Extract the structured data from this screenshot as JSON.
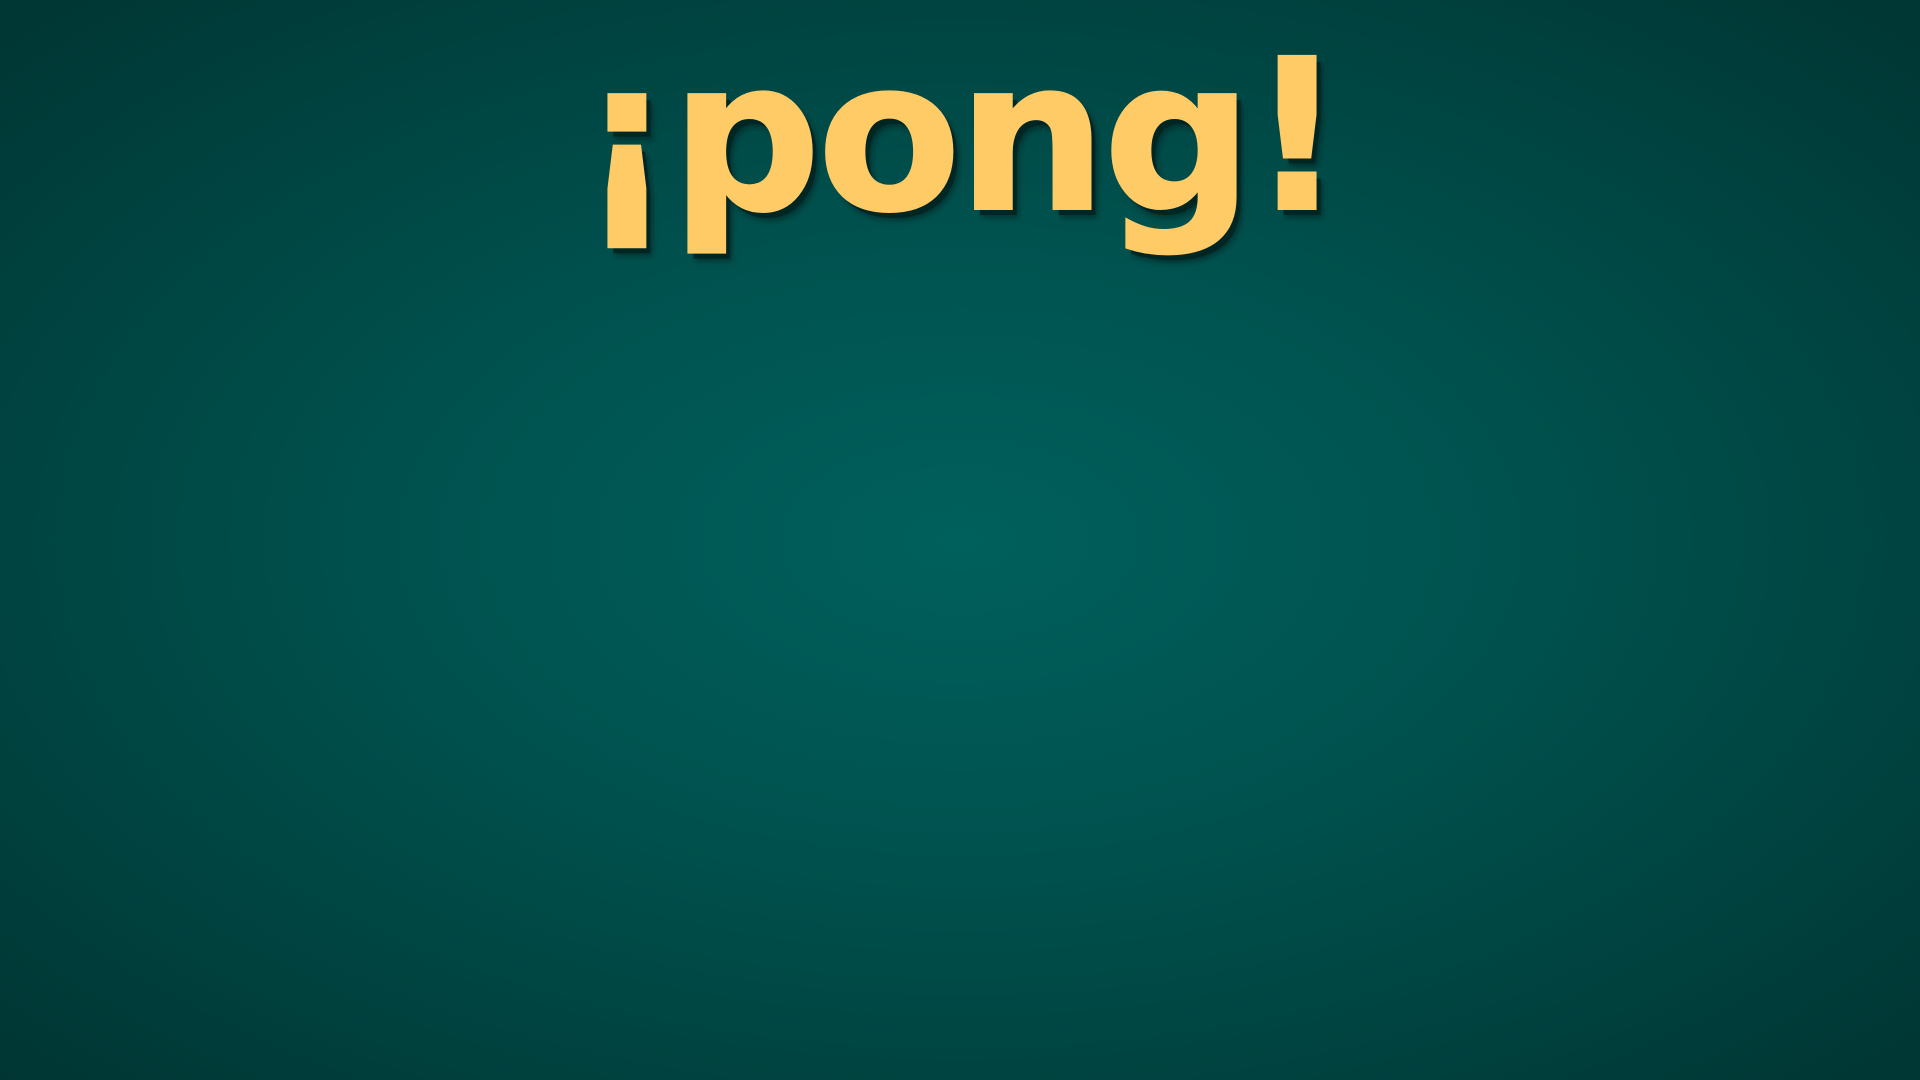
{
  "game": {
    "title": "¡pong!"
  },
  "colors": {
    "title": "#ffcb66",
    "background_center": "#00605c",
    "background_edge": "#003533",
    "title_shadow": "#002624"
  }
}
